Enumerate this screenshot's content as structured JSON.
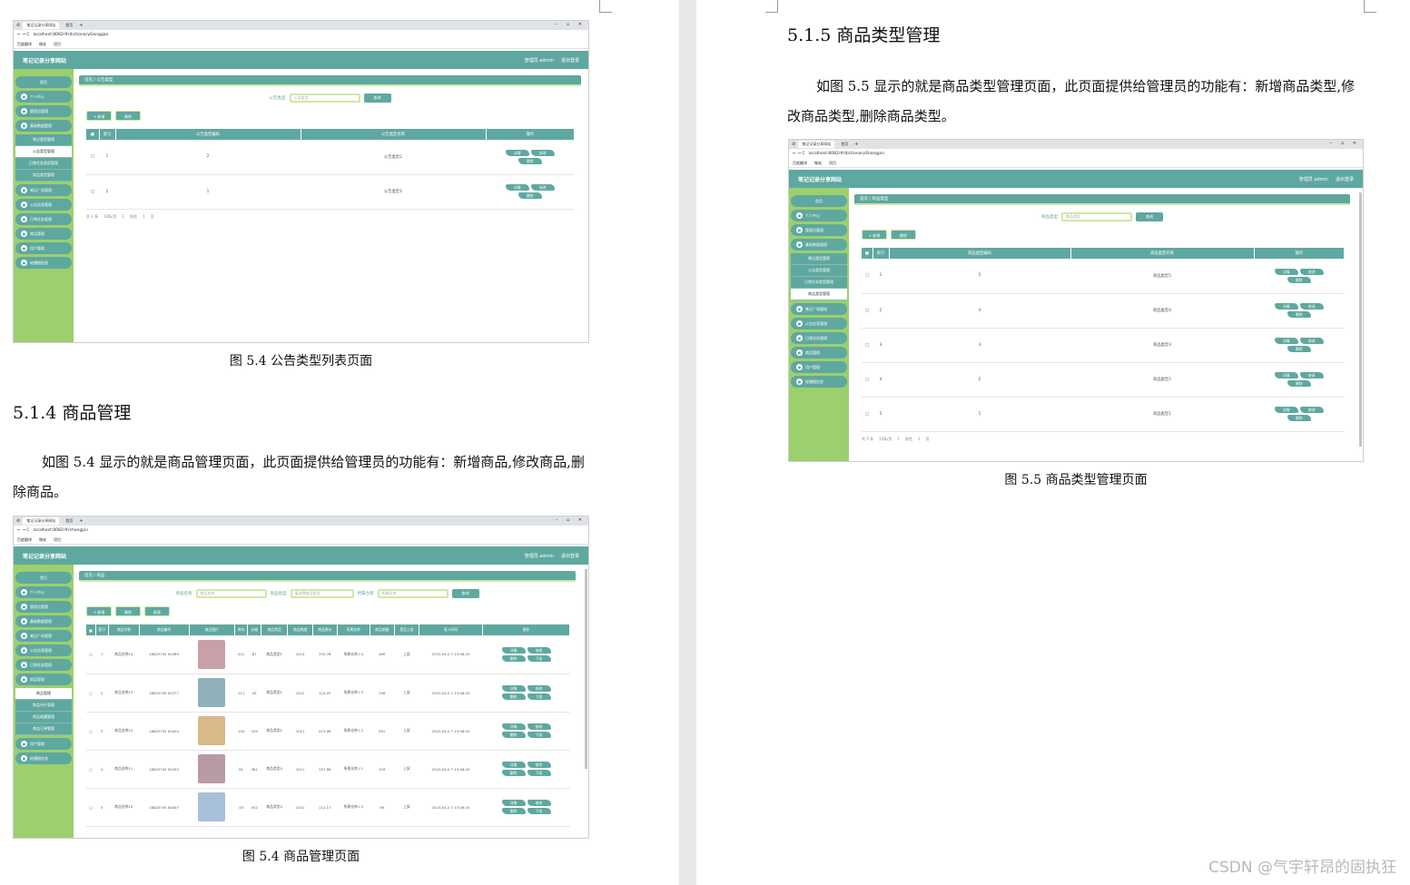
{
  "left_page": {
    "figure_54a": {
      "caption": "图 5.4  公告类型列表页面",
      "browser": {
        "tab_title": "笔记记录分享网站",
        "tab2_title": "首页",
        "url": "localhost:8082/#/dictionaryGonggao",
        "bookmarks": [
          "百度翻译",
          "微软",
          "项目"
        ]
      },
      "site": {
        "brand": "笔记记录分享网站",
        "user": "管理员 admin",
        "logout": "退出登录"
      },
      "sidebar": {
        "home": "首页",
        "items": [
          "个人中心",
          "管理员管理",
          "基础数据管理"
        ],
        "sub": [
          "笔记类型管理",
          "公告类型管理",
          "日常任务类型管理",
          "商品类型管理"
        ],
        "active_sub": "公告类型管理",
        "items_after": [
          "笔记广场管理",
          "公告信息管理",
          "日常任务管理",
          "商品管理",
          "用户管理",
          "轮播图信息"
        ]
      },
      "breadcrumb": "首页 / 公告类型",
      "search_label": "公告类型",
      "search_placeholder": "公告类型",
      "search_button": "查询",
      "add_button": "+ 新增",
      "delete_button": "删除",
      "headers": [
        "索引",
        "公告类型编码",
        "公告类型名称",
        "操作"
      ],
      "rows": [
        {
          "index": "1",
          "code": "2",
          "name": "公告类型2"
        },
        {
          "index": "2",
          "code": "1",
          "name": "公告类型1"
        }
      ],
      "ops": [
        "详情",
        "修改",
        "删除"
      ],
      "pager": [
        "共 2 条",
        "10条/页",
        "1",
        "前往",
        "1",
        "页"
      ]
    },
    "section_514": {
      "heading": "5.1.4  商品管理",
      "paragraph": "如图 5.4 显示的就是商品管理页面，此页面提供给管理员的功能有：新增商品,修改商品,删除商品。"
    },
    "figure_54b": {
      "caption": "图 5.4 商品管理页面",
      "browser": {
        "url": "localhost:8082/#/shangpin"
      },
      "breadcrumb": "首页 / 商品",
      "search_fields": [
        {
          "label": "商品名称",
          "placeholder": "商品名称"
        },
        {
          "label": "商品类型",
          "placeholder": "请选择商品类型"
        },
        {
          "label": "所属仓库",
          "placeholder": "所属仓库"
        }
      ],
      "search_button": "查询",
      "buttons": [
        "+ 新增",
        "删除",
        "报表"
      ],
      "sidebar_sub": [
        "商品管理",
        "商品评价管理",
        "商品收藏管理",
        "商品订单管理"
      ],
      "headers": [
        "索引",
        "商品名称",
        "商品编号",
        "商品图片",
        "库存",
        "价格",
        "商品类型",
        "商品热度",
        "商品原价",
        "所属仓库",
        "商品销量",
        "是否上架",
        "录入时间",
        "操作"
      ],
      "rows": [
        {
          "i": "1",
          "name": "商品名称14",
          "no": "16825745 00389",
          "stock": "412",
          "price": "87",
          "type": "商品类型1",
          "hot": "1014",
          "orig": "370.78",
          "wh": "所属仓库1 4",
          "sales": "465",
          "up": "上架",
          "time": "2023-04-2 7 13:48:20"
        },
        {
          "i": "2",
          "name": "商品名称13",
          "no": "16825745 00377",
          "stock": "111",
          "price": "45",
          "type": "商品类型1",
          "hot": "1012",
          "orig": "124.25",
          "wh": "所属仓库1 3",
          "sales": "256",
          "up": "上架",
          "time": "2023-04-2 7 13:48:20"
        },
        {
          "i": "3",
          "name": "商品名称12",
          "no": "16825745 00404",
          "stock": "154",
          "price": "229",
          "type": "商品类型2",
          "hot": "1011",
          "orig": "413.96",
          "wh": "所属仓库1 2",
          "sales": "591",
          "up": "上架",
          "time": "2023-04-2 7 13:48:20"
        },
        {
          "i": "4",
          "name": "商品名称11",
          "no": "16825745 00433",
          "stock": "81",
          "price": "481",
          "type": "商品类型4",
          "hot": "1011",
          "orig": "257.66",
          "wh": "所属仓库1 1",
          "sales": "329",
          "up": "上架",
          "time": "2023-04-2 7 13:48:20"
        },
        {
          "i": "5",
          "name": "商品名称10",
          "no": "16825745 00407",
          "stock": "43",
          "price": "452",
          "type": "商品类型4",
          "hot": "1010",
          "orig": "112.17",
          "wh": "所属仓库1 0",
          "sales": "90",
          "up": "上架",
          "time": "2023-04-2 7 13:48:20"
        }
      ],
      "ops": [
        "详情",
        "修改",
        "删除",
        "下架"
      ]
    }
  },
  "right_page": {
    "section_515": {
      "heading": "5.1.5  商品类型管理",
      "paragraph": "如图 5.5 显示的就是商品类型管理页面，此页面提供给管理员的功能有：新增商品类型,修改商品类型,删除商品类型。"
    },
    "figure_55": {
      "caption": "图 5.5  商品类型管理页面",
      "browser": {
        "url": "localhost:8082/#/dictionaryShangpin"
      },
      "breadcrumb": "首页 / 商品类型",
      "search_label": "商品类型",
      "search_placeholder": "商品类型",
      "search_button": "查询",
      "headers": [
        "索引",
        "商品类型编码",
        "商品类型名称",
        "操作"
      ],
      "active_sub": "商品类型管理",
      "rows": [
        {
          "index": "1",
          "code": "5",
          "name": "商品类型5"
        },
        {
          "index": "2",
          "code": "4",
          "name": "商品类型4"
        },
        {
          "index": "3",
          "code": "3",
          "name": "商品类型3"
        },
        {
          "index": "4",
          "code": "2",
          "name": "商品类型2"
        },
        {
          "index": "5",
          "code": "1",
          "name": "商品类型1"
        }
      ],
      "pager": [
        "共 5 条",
        "10条/页",
        "1",
        "前往",
        "1",
        "页"
      ]
    }
  },
  "watermark": "CSDN @气宇轩昂的固执狂",
  "colors": {
    "teal": "#5fa8a0",
    "green": "#9ccf6e",
    "light_green": "#cfe8a6"
  }
}
